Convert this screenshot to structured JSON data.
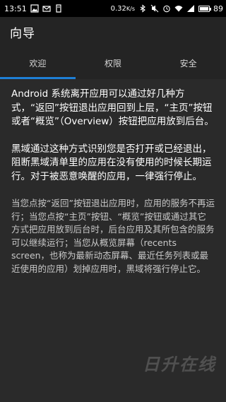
{
  "status_bar": {
    "time": "13:51",
    "speed_value": "0.32",
    "speed_unit": "K/s",
    "battery_level": "89",
    "battery_fraction": 0.89
  },
  "app_bar": {
    "title": "向导"
  },
  "tabs": [
    {
      "label": "欢迎",
      "active": true
    },
    {
      "label": "权限",
      "active": false
    },
    {
      "label": "安全",
      "active": false
    }
  ],
  "content": {
    "paragraphs": [
      "Android 系统离开应用可以通过好几种方式，“返回”按钮退出应用回到上层，“主页”按钮或者“概览”（Overview）按钮把应用放到后台。",
      "黑域通过这种方式识别您是否打开或已经退出，阻断黑域清单里的应用在没有使用的时候长期运行。对于被恶意唤醒的应用，一律强行停止。",
      "当您点按“返回”按钮退出应用时，应用的服务不再运行；当您点按“主页”按钮、“概览”按钮或通过其它方式把应用放到后台时，后台应用及其所包含的服务可以继续运行；当您从概览屏幕（recents screen，也称为最新动态屏幕、最近任务列表或最近使用的应用）划掉应用时，黑域将强行停止它。"
    ]
  },
  "watermark": "日升在线",
  "colors": {
    "appbar_bg": "#242424",
    "content_bg": "#2a2a2a",
    "tab_indicator": "#1e7fd6"
  }
}
